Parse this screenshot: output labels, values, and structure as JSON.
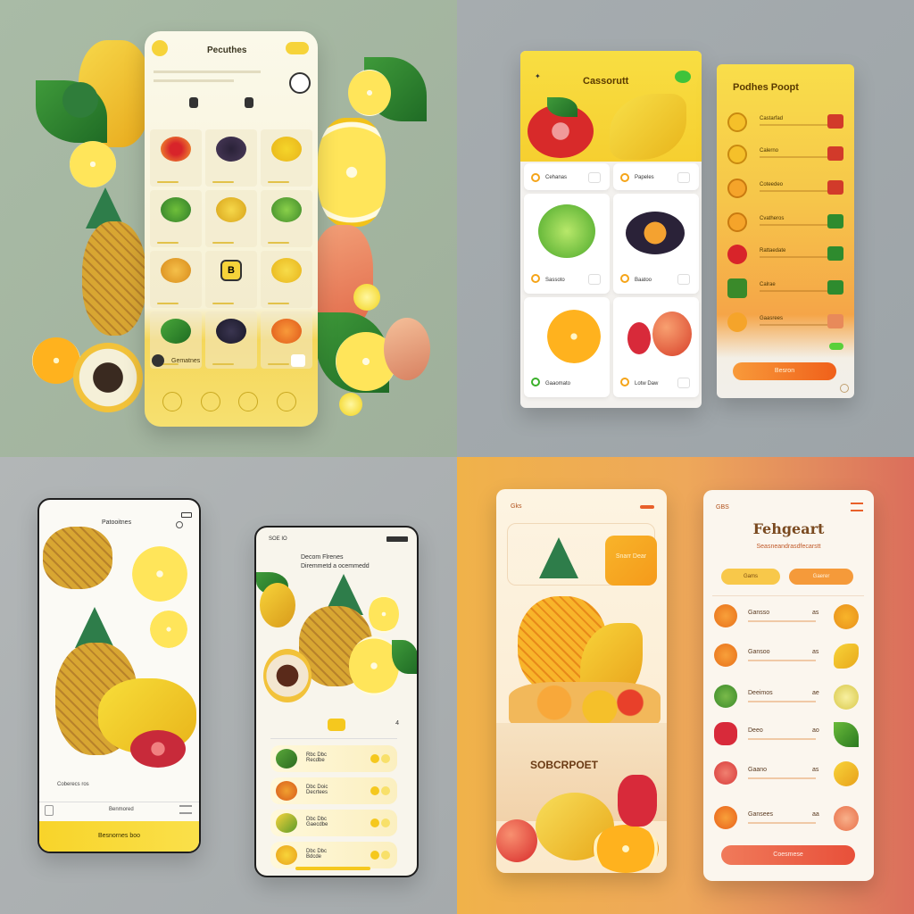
{
  "q1": {
    "title": "Pecuthes",
    "menu_label": "Gematnes",
    "center_badge": "B"
  },
  "q2": {
    "left_title": "Cassorutt",
    "right_title": "Podhes Poopt",
    "card_labels": [
      "Cehanas",
      "Papeles",
      "Sassoto",
      "Baatoo",
      "Gaaomato",
      "Lotw Daw"
    ],
    "row_labels": [
      "Castarfad",
      "Calerno",
      "Coteedeo",
      "Cvatheros",
      "Rattaedate",
      "Calrae",
      "Gaasrees"
    ],
    "cta": "Besron",
    "colors": {
      "accent": "#f58a24",
      "check_red": "#d23a2a",
      "check_green": "#2e8b2e"
    }
  },
  "q3": {
    "left_title": "Patooitnes",
    "left_footer_text": "Coberecs ros",
    "left_footer_right": "Benmored",
    "left_button": "Besnornes boo",
    "right_status": "SOE IO",
    "right_heading1": "Decom Flrenes",
    "right_heading2": "Diremmetd a ocemmedd",
    "right_count": "4",
    "rows": [
      {
        "name": "Rbc Dbc",
        "sub": "Recdbe"
      },
      {
        "name": "Dbc Doic",
        "sub": "Decrtees"
      },
      {
        "name": "Dbc Dbc",
        "sub": "Gaecdbe"
      },
      {
        "name": "Dbc Dbc",
        "sub": "Bdcde"
      }
    ]
  },
  "q4": {
    "left_tag": "Gks",
    "promo": "Snarr Dear",
    "basket_label": "SOBCRPOET",
    "right_tag": "GBS",
    "title": "Fehgeart",
    "subtitle": "Seasneandrasdfecarstt",
    "chip1": "Gams",
    "chip2": "Gaerer",
    "rows": [
      {
        "name": "Gansso",
        "qty": "as"
      },
      {
        "name": "Gansoo",
        "qty": "as"
      },
      {
        "name": "Deeimos",
        "qty": "ae"
      },
      {
        "name": "Deeo",
        "qty": "ao"
      },
      {
        "name": "Gaano",
        "qty": "as"
      },
      {
        "name": "Gansees",
        "qty": "aa"
      }
    ],
    "cta": "Coesmese"
  }
}
